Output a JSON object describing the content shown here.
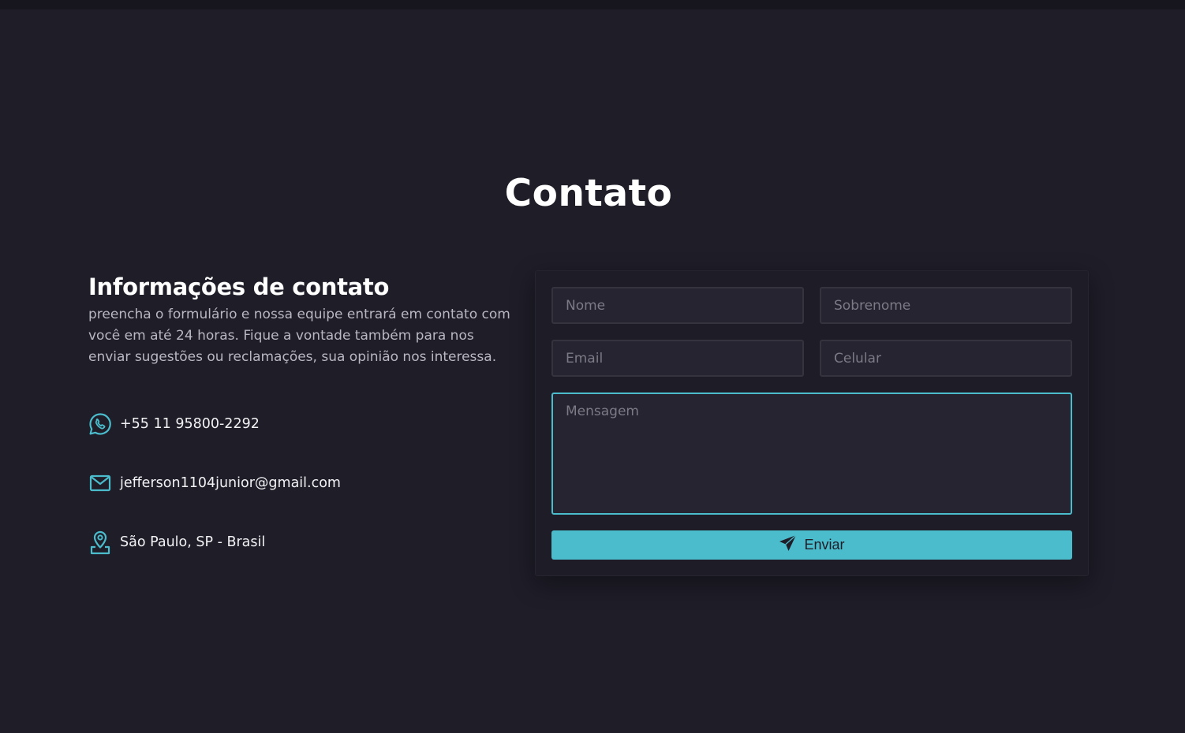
{
  "page": {
    "title": "Contato"
  },
  "info": {
    "heading": "Informações de contato",
    "description": "preencha o formulário e nossa equipe entrará em contato com você em até 24 horas. Fique a vontade também para nos enviar sugestões ou reclamações, sua opinião nos interessa.",
    "phone": "+55 11 95800-2292",
    "email": "jefferson1104junior@gmail.com",
    "location": "São Paulo, SP - Brasil",
    "phone_icon": "whatsapp-icon",
    "email_icon": "mail-icon",
    "location_icon": "map-pin-icon"
  },
  "form": {
    "nome_placeholder": "Nome",
    "sobrenome_placeholder": "Sobrenome",
    "email_placeholder": "Email",
    "celular_placeholder": "Celular",
    "mensagem_placeholder": "Mensagem",
    "submit_label": "Enviar",
    "submit_icon": "send-icon"
  },
  "colors": {
    "accent": "#4bbccc",
    "background": "#1e1d28",
    "input_background": "#252430"
  }
}
